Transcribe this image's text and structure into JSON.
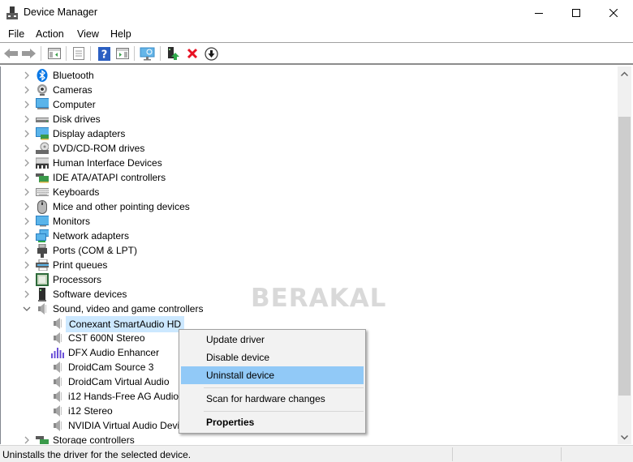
{
  "window": {
    "title": "Device Manager",
    "controls": {
      "minimize": "minimize",
      "maximize": "maximize",
      "close": "close"
    }
  },
  "menubar": {
    "items": [
      {
        "label": "File"
      },
      {
        "label": "Action"
      },
      {
        "label": "View"
      },
      {
        "label": "Help"
      }
    ]
  },
  "toolbar": {
    "buttons": [
      {
        "icon": "back-arrow-icon",
        "tooltip": "Back"
      },
      {
        "icon": "forward-arrow-icon",
        "tooltip": "Forward"
      },
      {
        "icon": "show-hide-console-tree-icon"
      },
      {
        "icon": "properties-sheet-icon"
      },
      {
        "icon": "help-icon"
      },
      {
        "icon": "show-hide-action-pane-icon"
      },
      {
        "icon": "scan-hardware-icon"
      },
      {
        "icon": "update-driver-icon"
      },
      {
        "icon": "uninstall-device-icon"
      },
      {
        "icon": "disable-device-icon"
      }
    ]
  },
  "tree": {
    "categories": [
      {
        "label": "Bluetooth",
        "icon": "bluetooth-icon",
        "expanded": false
      },
      {
        "label": "Cameras",
        "icon": "camera-icon",
        "expanded": false
      },
      {
        "label": "Computer",
        "icon": "computer-icon",
        "expanded": false
      },
      {
        "label": "Disk drives",
        "icon": "disk-drive-icon",
        "expanded": false
      },
      {
        "label": "Display adapters",
        "icon": "display-adapter-icon",
        "expanded": false
      },
      {
        "label": "DVD/CD-ROM drives",
        "icon": "dvd-drive-icon",
        "expanded": false
      },
      {
        "label": "Human Interface Devices",
        "icon": "hid-icon",
        "expanded": false
      },
      {
        "label": "IDE ATA/ATAPI controllers",
        "icon": "ide-controller-icon",
        "expanded": false
      },
      {
        "label": "Keyboards",
        "icon": "keyboard-icon",
        "expanded": false
      },
      {
        "label": "Mice and other pointing devices",
        "icon": "mouse-icon",
        "expanded": false
      },
      {
        "label": "Monitors",
        "icon": "monitor-icon",
        "expanded": false
      },
      {
        "label": "Network adapters",
        "icon": "network-adapter-icon",
        "expanded": false
      },
      {
        "label": "Ports (COM & LPT)",
        "icon": "port-icon",
        "expanded": false
      },
      {
        "label": "Print queues",
        "icon": "printer-icon",
        "expanded": false
      },
      {
        "label": "Processors",
        "icon": "processor-icon",
        "expanded": false
      },
      {
        "label": "Software devices",
        "icon": "software-device-icon",
        "expanded": false
      },
      {
        "label": "Sound, video and game controllers",
        "icon": "speaker-icon",
        "expanded": true
      }
    ],
    "sound_children": [
      {
        "label": "Conexant SmartAudio HD",
        "icon": "speaker-icon",
        "selected": true
      },
      {
        "label": "CST 600N Stereo",
        "icon": "speaker-icon",
        "selected": false
      },
      {
        "label": "DFX Audio Enhancer",
        "icon": "equalizer-icon",
        "selected": false
      },
      {
        "label": "DroidCam Source 3",
        "icon": "speaker-icon",
        "selected": false
      },
      {
        "label": "DroidCam Virtual Audio",
        "icon": "speaker-icon",
        "selected": false
      },
      {
        "label": "i12 Hands-Free AG Audio",
        "icon": "speaker-icon",
        "selected": false
      },
      {
        "label": "i12 Stereo",
        "icon": "speaker-icon",
        "selected": false
      },
      {
        "label": "NVIDIA Virtual Audio Device",
        "icon": "speaker-icon",
        "selected": false
      }
    ],
    "after": [
      {
        "label": "Storage controllers",
        "icon": "storage-controller-icon",
        "expanded": false
      }
    ]
  },
  "watermark": "BERAKAL",
  "context_menu": {
    "items": [
      {
        "label": "Update driver",
        "highlighted": false,
        "bold": false
      },
      {
        "label": "Disable device",
        "highlighted": false,
        "bold": false
      },
      {
        "label": "Uninstall device",
        "highlighted": true,
        "bold": false
      },
      {
        "label": "Scan for hardware changes",
        "highlighted": false,
        "bold": false
      },
      {
        "label": "Properties",
        "highlighted": false,
        "bold": true
      }
    ]
  },
  "scrollbar": {
    "position_fraction": 0.2,
    "visible_fraction": 0.8
  },
  "statusbar": {
    "text": "Uninstalls the driver for the selected device."
  },
  "colors": {
    "selection": "#cce8ff",
    "menu_highlight": "#91c9f7",
    "uninstall_red": "#e81123",
    "bluetooth_blue": "#0a78e6"
  }
}
